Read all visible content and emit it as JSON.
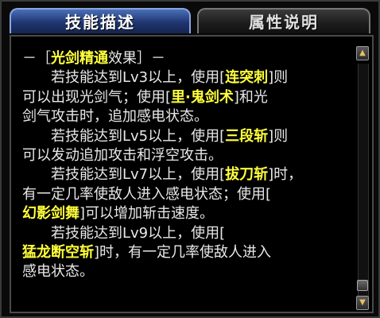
{
  "tabs": [
    {
      "label": "技能描述",
      "active": true
    },
    {
      "label": "属性说明",
      "active": false
    }
  ],
  "content": {
    "lines": [
      {
        "indent": false,
        "segments": [
          {
            "t": "－［",
            "hl": false
          },
          {
            "t": "光剑精通",
            "hl": true
          },
          {
            "t": "效果］－",
            "hl": false
          }
        ]
      },
      {
        "indent": true,
        "segments": [
          {
            "t": "若技能达到Lv3以上，使用[",
            "hl": false
          },
          {
            "t": "连突刺",
            "hl": true
          },
          {
            "t": "]则",
            "hl": false
          }
        ]
      },
      {
        "indent": false,
        "segments": [
          {
            "t": "可以出现光剑气；使用[",
            "hl": false
          },
          {
            "t": "里·鬼剑术",
            "hl": true
          },
          {
            "t": "]和光",
            "hl": false
          }
        ]
      },
      {
        "indent": false,
        "segments": [
          {
            "t": "剑气攻击时，追加感电状态。",
            "hl": false
          }
        ]
      },
      {
        "indent": true,
        "segments": [
          {
            "t": "若技能达到Lv5以上，使用[",
            "hl": false
          },
          {
            "t": "三段斩",
            "hl": true
          },
          {
            "t": "]则",
            "hl": false
          }
        ]
      },
      {
        "indent": false,
        "segments": [
          {
            "t": "可以发动追加攻击和浮空攻击。",
            "hl": false
          }
        ]
      },
      {
        "indent": true,
        "segments": [
          {
            "t": "若技能达到Lv7以上，使用[",
            "hl": false
          },
          {
            "t": "拔刀斩",
            "hl": true
          },
          {
            "t": "]时，",
            "hl": false
          }
        ]
      },
      {
        "indent": false,
        "segments": [
          {
            "t": "有一定几率使敌人进入感电状态；使用[",
            "hl": false
          }
        ]
      },
      {
        "indent": false,
        "segments": [
          {
            "t": "幻影剑舞",
            "hl": true
          },
          {
            "t": "]可以增加斩击速度。",
            "hl": false
          }
        ]
      },
      {
        "indent": true,
        "segments": [
          {
            "t": "若技能达到Lv9以上，使用[",
            "hl": false
          }
        ]
      },
      {
        "indent": false,
        "segments": [
          {
            "t": "猛龙断空斩",
            "hl": true
          },
          {
            "t": "]时，有一定几率使敌人进入",
            "hl": false
          }
        ]
      },
      {
        "indent": false,
        "segments": [
          {
            "t": "感电状态。",
            "hl": false
          }
        ]
      }
    ]
  },
  "scrollbar": {
    "up_icon": "triangle-up-icon",
    "down_icon": "triangle-down-icon",
    "position": 1.0
  },
  "colors": {
    "highlight": "#ffff3c",
    "text": "#e8e8e8",
    "active_tab": "#1f3570"
  }
}
